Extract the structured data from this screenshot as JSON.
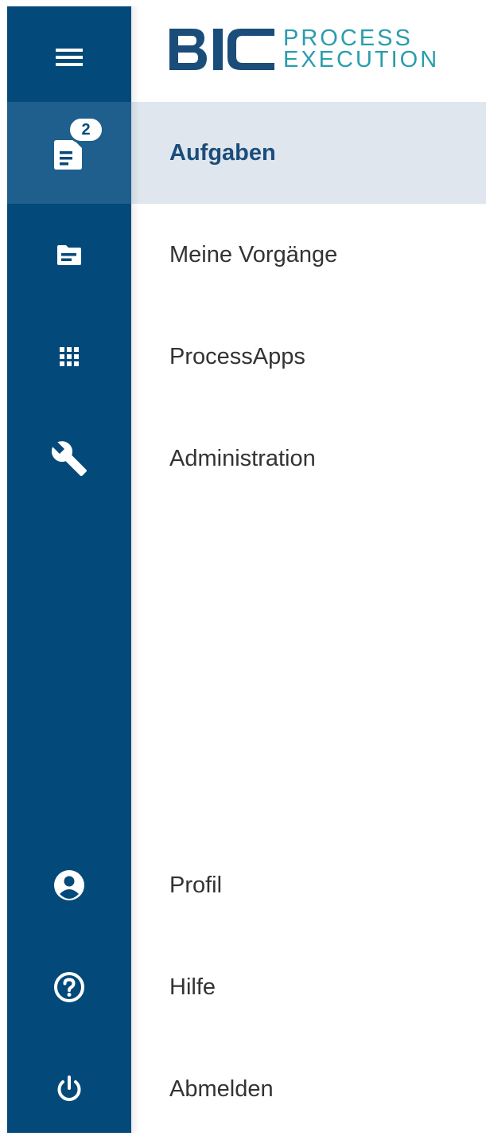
{
  "brand": {
    "name": "BIC",
    "product_line1": "PROCESS",
    "product_line2": "EXECUTION",
    "colors": {
      "bic": "#1b4d7a",
      "product": "#2a9dac"
    }
  },
  "rail": {
    "menu_icon": "hamburger-menu-icon",
    "background": "#034a7a",
    "active_background": "#1e5f8d"
  },
  "nav": {
    "tasks": {
      "label": "Aufgaben",
      "icon": "clipboard-tasks-icon",
      "badge": "2",
      "active": true
    },
    "cases": {
      "label": "Meine Vorgänge",
      "icon": "folder-icon"
    },
    "apps": {
      "label": "ProcessApps",
      "icon": "apps-grid-icon"
    },
    "admin": {
      "label": "Administration",
      "icon": "wrench-icon"
    },
    "profile": {
      "label": "Profil",
      "icon": "account-circle-icon"
    },
    "help": {
      "label": "Hilfe",
      "icon": "help-circle-icon"
    },
    "logout": {
      "label": "Abmelden",
      "icon": "power-icon"
    }
  },
  "colors": {
    "active_item_background": "#dfe6ee",
    "active_item_text": "#1b4d7a",
    "item_text": "#333333"
  }
}
